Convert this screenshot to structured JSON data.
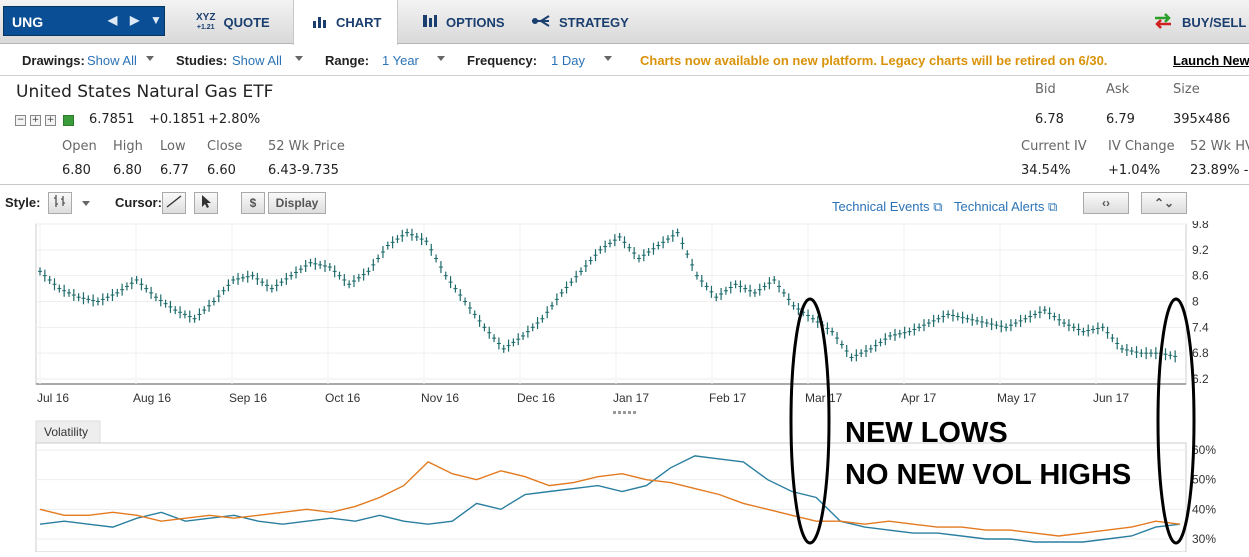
{
  "topbar": {
    "symbol": "UNG",
    "tabs": [
      {
        "label": "QUOTE",
        "icon": "xyz-quote-icon"
      },
      {
        "label": "CHART",
        "icon": "bar-chart-icon"
      },
      {
        "label": "OPTIONS",
        "icon": "options-icon"
      },
      {
        "label": "STRATEGY",
        "icon": "strategy-icon"
      }
    ],
    "buysell": "BUY/SELL",
    "xyz_label": "XYZ",
    "xyz_sub": "+1.21"
  },
  "toolbar": {
    "drawings_label": "Drawings:",
    "drawings_value": "Show All",
    "studies_label": "Studies:",
    "studies_value": "Show All",
    "range_label": "Range:",
    "range_value": "1 Year",
    "frequency_label": "Frequency:",
    "frequency_value": "1 Day",
    "notice": "Charts now available on new platform. Legacy charts will be retired on 6/30.",
    "launch": "Launch New"
  },
  "quote": {
    "name": "United States Natural Gas ETF",
    "last": "6.7851",
    "change": "+0.1851",
    "change_pct": "+2.80%",
    "open_label": "Open",
    "open": "6.80",
    "high_label": "High",
    "high": "6.80",
    "low_label": "Low",
    "low": "6.77",
    "close_label": "Close",
    "close": "6.60",
    "wk52_label": "52 Wk Price",
    "wk52": "6.43-9.735",
    "bid_label": "Bid",
    "bid": "6.78",
    "ask_label": "Ask",
    "ask": "6.79",
    "size_label": "Size",
    "size": "395x486",
    "iv_label": "Current IV",
    "iv": "34.54%",
    "ivchg_label": "IV Change",
    "ivchg": "+1.04%",
    "hv_label": "52 Wk HV",
    "hv": "23.89% -"
  },
  "stylebar": {
    "style_label": "Style:",
    "cursor_label": "Cursor:",
    "dollar": "$",
    "display": "Display",
    "tech_events": "Technical Events",
    "tech_alerts": "Technical Alerts"
  },
  "volatility_label": "Volatility",
  "annotation": {
    "line1": "NEW LOWS",
    "line2": "NO NEW VOL HIGHS"
  },
  "colors": {
    "price": "#1e6b6b",
    "iv_series": "#2a7fa0",
    "hv_series": "#e37a1f",
    "accent_blue": "#2b73b6",
    "notice": "#d9920a"
  },
  "chart_data": [
    {
      "type": "line",
      "categories": [
        "Jul 16",
        "Aug 16",
        "Sep 16",
        "Oct 16",
        "Nov 16",
        "Dec 16",
        "Jan 17",
        "Feb 17",
        "Mar 17",
        "Apr 17",
        "May 17",
        "Jun 17"
      ],
      "y_ticks": [
        "9.8",
        "9.2",
        "8.6",
        "8",
        "7.4",
        "6.8",
        "6.2"
      ],
      "ylim": [
        6.2,
        9.8
      ],
      "series": [
        {
          "values": [
            8.7,
            8.3,
            8.1,
            8.0,
            8.2,
            8.5,
            8.1,
            7.8,
            7.6,
            8.0,
            8.5,
            8.6,
            8.3,
            8.6,
            8.9,
            8.8,
            8.4,
            8.7,
            9.3,
            9.6,
            9.4,
            8.6,
            8.0,
            7.4,
            6.9,
            7.2,
            7.6,
            8.2,
            8.7,
            9.2,
            9.5,
            9.0,
            9.3,
            9.6,
            8.6,
            8.1,
            8.4,
            8.2,
            8.5,
            7.9,
            7.6,
            7.3,
            6.7,
            6.9,
            7.2,
            7.3,
            7.5,
            7.7,
            7.6,
            7.5,
            7.4,
            7.6,
            7.8,
            7.5,
            7.3,
            7.4,
            6.9,
            6.8,
            6.8,
            6.7
          ]
        }
      ]
    },
    {
      "type": "line",
      "categories": [
        "Jul 16",
        "Aug 16",
        "Sep 16",
        "Oct 16",
        "Nov 16",
        "Dec 16",
        "Jan 17",
        "Feb 17",
        "Mar 17",
        "Apr 17",
        "May 17",
        "Jun 17"
      ],
      "y_ticks": [
        "60%",
        "50%",
        "40%",
        "30%"
      ],
      "ylim": [
        30,
        60
      ],
      "series": [
        {
          "values": [
            35,
            36,
            35,
            34,
            37,
            39,
            36,
            37,
            38,
            36,
            35,
            36,
            37,
            36,
            38,
            36,
            35,
            36,
            42,
            40,
            45,
            46,
            47,
            48,
            46,
            48,
            54,
            58,
            57,
            56,
            50,
            46,
            44,
            36,
            34,
            33,
            32,
            32,
            31,
            30,
            30,
            29,
            29,
            29,
            30,
            31,
            34,
            35
          ]
        },
        {
          "values": [
            40,
            38,
            38,
            39,
            38,
            36,
            37,
            38,
            37,
            38,
            39,
            40,
            39,
            41,
            44,
            48,
            56,
            52,
            50,
            53,
            51,
            48,
            49,
            51,
            52,
            50,
            49,
            47,
            45,
            42,
            40,
            38,
            36,
            36,
            35,
            36,
            35,
            34,
            34,
            33,
            33,
            32,
            31,
            32,
            33,
            34,
            36,
            35
          ]
        }
      ]
    }
  ]
}
